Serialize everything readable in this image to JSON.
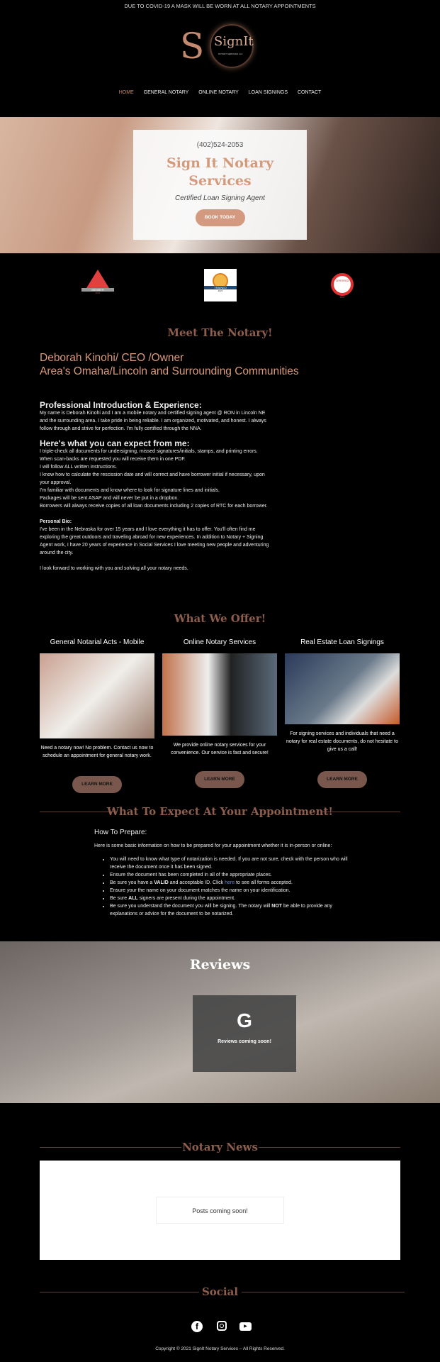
{
  "banner": "DUE TO COVID-19 A MASK WILL BE WORN AT ALL NOTARY APPOINTMENTS",
  "logo": {
    "letter": "S",
    "name": "SignIt",
    "tagline": "NOTARY SERVICES LLC"
  },
  "nav": [
    "HOME",
    "GENERAL NOTARY",
    "ONLINE NOTARY",
    "LOAN SIGNINGS",
    "CONTACT"
  ],
  "hero": {
    "phone": "(402)524-2053",
    "title": "Sign It Notary Services",
    "subtitle": "Certified Loan Signing Agent",
    "button": "BOOK TODAY"
  },
  "badges": [
    {
      "label": "MEMBER",
      "year": "2021"
    },
    {
      "label": "TRAINED",
      "year": "2021"
    },
    {
      "label": "CERTIFIED",
      "year": "2021"
    }
  ],
  "meet": {
    "heading": "Meet The Notary!",
    "name": "Deborah Kinohi/ CEO /Owner",
    "area": "Area's Omaha/Lincoln and Surrounding Communities",
    "intro_heading": "Professional Introduction & Experience:",
    "intro": "My name is Deborah Kinohi and I am a mobile notary and certified signing agent @ RON in Lincoln NE and the surrounding area. I take pride in being reliable. I am organized, motivated, and honest. I always follow through and strive for perfection. I'm fully certified through the NNA.",
    "expect_heading": "Here's what you can expect from me:",
    "expect": [
      "I triple-check all documents for undersigning, missed signatures/initials, stamps, and printing errors.",
      "When scan-backs are requested you will receive them in one PDF.",
      "I will follow ALL written instructions.",
      "I know how to calculate the rescission date and will correct and have borrower initial if necessary, upon your approval.",
      "I'm familiar with documents and know where to look for signature lines and initials.",
      "Packages will be sent ASAP and will never be put in a dropbox.",
      "Borrowers will always receive copies of all loan documents including 2 copies of RTC for each borrower."
    ],
    "bio_heading": "Personal Bio:",
    "bio": "I've been in the Nebraska for over 15 years and I love everything it has to offer. You'll often find me exploring the great outdoors and traveling abroad for new experiences. In addition to Notary + Signing Agent work, I have 20 years of experience in Social Services I love meeting new people and adventuring around the city.",
    "closing": "I look forward to working with you and solving all your notary needs."
  },
  "offer": {
    "heading": "What We Offer!",
    "cards": [
      {
        "title": "General Notarial Acts - Mobile",
        "desc": "Need a notary now! No problem. Contact us now to schedule an appointment for general notary work.",
        "button": "LEARN MORE"
      },
      {
        "title": "Online Notary Services",
        "desc": "We provide online notary services for your convenience. Our service is fast and secure!",
        "button": "LEARN MORE"
      },
      {
        "title": "Real Estate Loan Signings",
        "desc": "For signing services and individuals that need a notary for real estate documents, do not hesitate to give us a call!",
        "button": "LEARN MORE"
      }
    ]
  },
  "appointment": {
    "heading": "What To Expect At Your Appointment!",
    "subheading": "How To Prepare:",
    "intro": "Here is some basic information on how to be prepared for your appointment whether it is in-person or online:",
    "items": [
      "You will need to know what type of notarization is needed. If you are not sure, check with the person who will receive the document once it has been signed.",
      "Ensure the document has been completed in all of the appropriate places.",
      "Be sure you have a VALID and acceptable ID. Click here  to see all forms accepted.",
      "Ensure your the name on your document matches the name on your identification.",
      "Be sure ALL signers are present during the appointment.",
      "Be sure you understand the document you will be signing. The notary will NOT be able to provide any explanations or advice for the document to be notarized."
    ],
    "link": "here"
  },
  "reviews": {
    "heading": "Reviews",
    "icon": "google-icon",
    "text": "Reviews coming soon!"
  },
  "news": {
    "heading": "Notary News",
    "text": "Posts coming soon!"
  },
  "social": {
    "heading": "Social",
    "icons": [
      "facebook-icon",
      "instagram-icon",
      "youtube-icon"
    ]
  },
  "footer": "Copyright © 2021 SignIt Notary Services – All Rights Reserved."
}
